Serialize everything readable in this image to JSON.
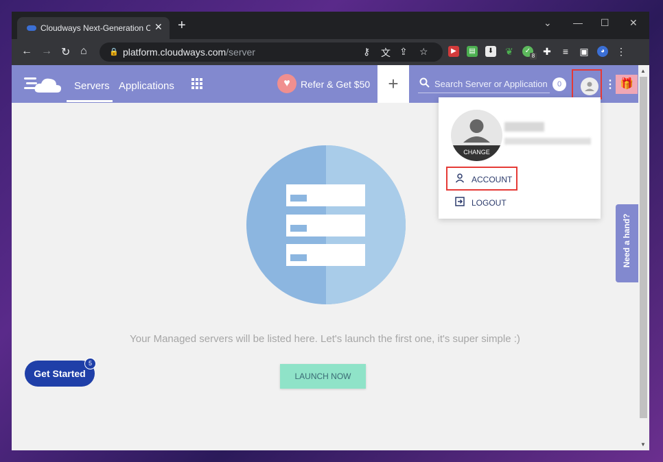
{
  "browser": {
    "tab_title": "Cloudways Next-Generation Clo",
    "tab_close": "✕",
    "new_tab": "+",
    "window_controls": [
      "⌄",
      "—",
      "☐",
      "✕"
    ],
    "url_host": "platform.cloudways.com",
    "url_path": "/server",
    "extension_badge": "8"
  },
  "header": {
    "nav": {
      "servers": "Servers",
      "applications": "Applications"
    },
    "refer": "Refer & Get $50",
    "add": "+",
    "search_placeholder": "Search Server or Application",
    "notification_count": "0",
    "accent_color": "#8289cf"
  },
  "account_menu": {
    "change_label": "CHANGE",
    "account_label": "ACCOUNT",
    "logout_label": "LOGOUT"
  },
  "main": {
    "empty_message": "Your Managed servers will be listed here. Let's launch the first one, it's super simple :)",
    "launch_button": "LAUNCH NOW"
  },
  "widgets": {
    "get_started": "Get Started",
    "get_started_badge": "5",
    "need_hand": "Need a hand?"
  }
}
